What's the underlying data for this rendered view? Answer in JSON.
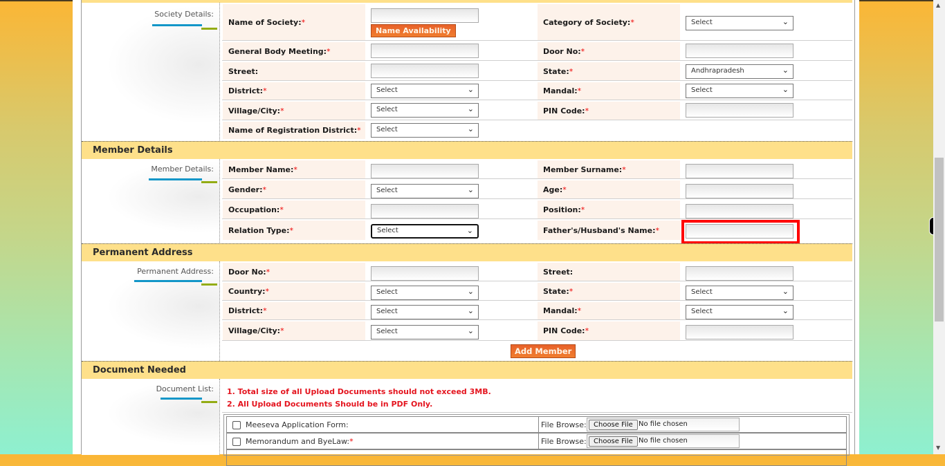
{
  "society": {
    "side_label": "Society Details:",
    "name_of_society": {
      "label": "Name of  Society:",
      "required": "*",
      "value": "",
      "button": "Name Availability"
    },
    "category": {
      "label": "Category of Society:",
      "required": "*",
      "selected": "Select"
    },
    "general_body_meeting": {
      "label": "General Body Meeting:",
      "required": "*",
      "value": ""
    },
    "door_no": {
      "label": "Door No:",
      "required": "*",
      "value": ""
    },
    "street": {
      "label": "Street:",
      "value": ""
    },
    "state": {
      "label": "State:",
      "required": "*",
      "selected": "Andhrapradesh"
    },
    "district": {
      "label": "District:",
      "required": "*",
      "selected": "Select"
    },
    "mandal": {
      "label": "Mandal:",
      "required": "*",
      "selected": "Select"
    },
    "village_city": {
      "label": "Village/City:",
      "required": "*",
      "selected": "Select"
    },
    "pin_code": {
      "label": "PIN Code:",
      "required": "*",
      "value": ""
    },
    "registration_district": {
      "label": "Name of Registration District:",
      "required": "*",
      "selected": "Select"
    }
  },
  "member": {
    "section_title": "Member Details",
    "side_label": "Member Details:",
    "member_name": {
      "label": "Member Name:",
      "required": "*",
      "value": ""
    },
    "member_surname": {
      "label": "Member Surname:",
      "required": "*",
      "value": ""
    },
    "gender": {
      "label": "Gender:",
      "required": "*",
      "selected": "Select"
    },
    "age": {
      "label": "Age:",
      "required": "*",
      "value": ""
    },
    "occupation": {
      "label": "Occupation:",
      "required": "*",
      "value": ""
    },
    "position": {
      "label": "Position:",
      "required": "*",
      "value": ""
    },
    "relation_type": {
      "label": "Relation Type:",
      "required": "*",
      "selected": "Select"
    },
    "father_husband_name": {
      "label": "Father's/Husband's Name:",
      "required": "*",
      "value": ""
    }
  },
  "permanent_address": {
    "section_title": "Permanent Address",
    "side_label": "Permanent Address:",
    "door_no": {
      "label": "Door No:",
      "required": "*",
      "value": ""
    },
    "street": {
      "label": "Street:",
      "value": ""
    },
    "country": {
      "label": "Country:",
      "required": "*",
      "selected": "Select"
    },
    "state": {
      "label": "State:",
      "required": "*",
      "selected": "Select"
    },
    "district": {
      "label": "District:",
      "required": "*",
      "selected": "Select"
    },
    "mandal": {
      "label": "Mandal:",
      "required": "*",
      "selected": "Select"
    },
    "village_city": {
      "label": "Village/City:",
      "required": "*",
      "selected": "Select"
    },
    "pin_code": {
      "label": "PIN Code:",
      "required": "*",
      "value": ""
    },
    "add_member_button": "Add Member"
  },
  "documents": {
    "section_title": "Document Needed",
    "side_label": "Document List:",
    "notes": [
      "1. Total size of all Upload Documents should not exceed 3MB.",
      "2. All Upload Documents Should be in PDF Only."
    ],
    "items": [
      {
        "name": "Meeseva Application Form:",
        "required": "",
        "browse_label": "File Browse:",
        "choose_button": "Choose File",
        "file_status": "No file chosen"
      },
      {
        "name": "Memorandum and ByeLaw:",
        "required": "*",
        "browse_label": "File Browse:",
        "choose_button": "Choose File",
        "file_status": "No file chosen"
      }
    ]
  },
  "icons": {
    "chevron": "❯",
    "scroll_up": "▲",
    "scroll_down": "▼"
  },
  "colors": {
    "section_header": "#fee08a",
    "label_bg": "#fdf2ea",
    "accent_orange": "#e8622a",
    "required_red": "#e00000",
    "highlight": "#ff0000"
  }
}
